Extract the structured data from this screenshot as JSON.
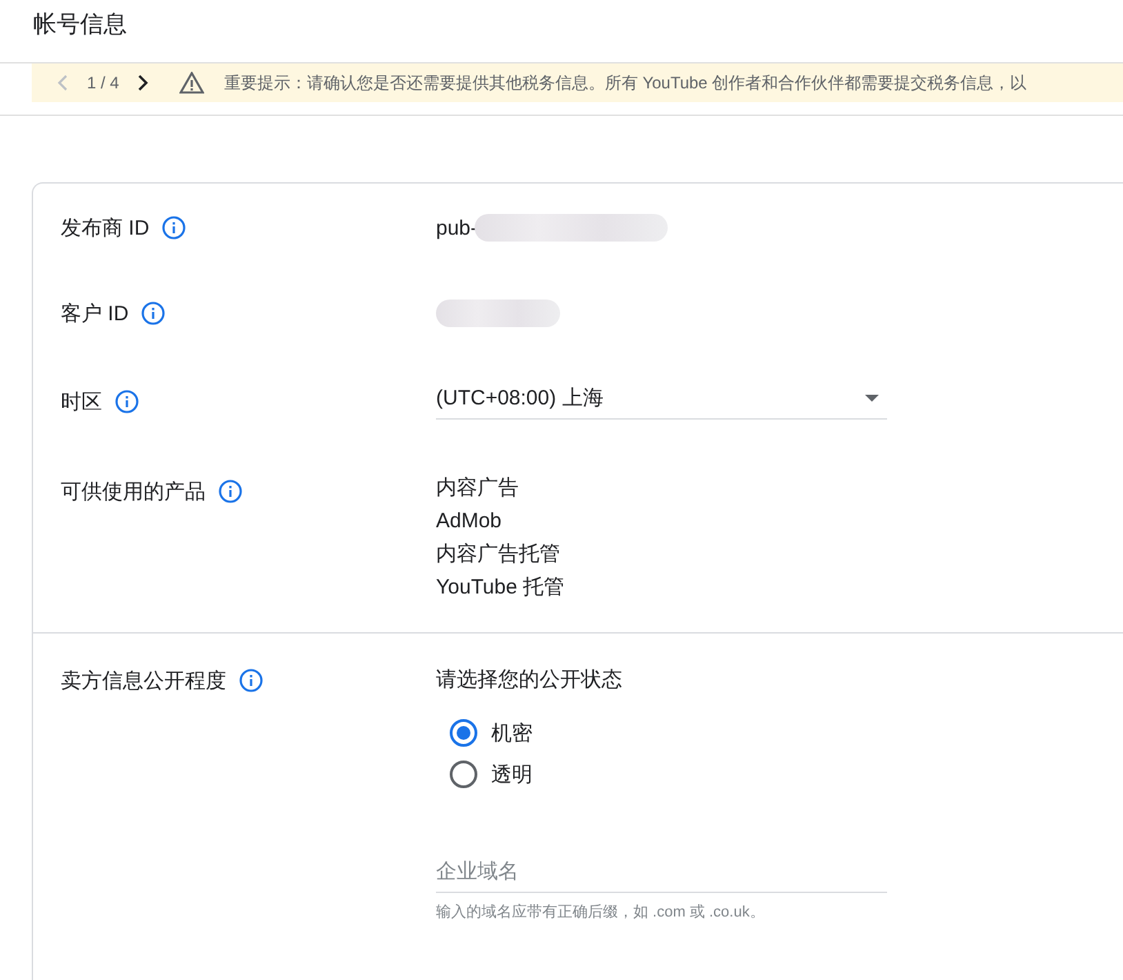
{
  "header": {
    "title": "帐号信息"
  },
  "banner": {
    "pager": "1 / 4",
    "message": "重要提示：请确认您是否还需要提供其他税务信息。所有 YouTube 创作者和合作伙伴都需要提交税务信息，以"
  },
  "fields": [
    {
      "kind": "redacted",
      "label": "发布商 ID",
      "value": "pub-"
    },
    {
      "kind": "redacted",
      "label": "客户 ID"
    },
    {
      "kind": "select",
      "label": "时区",
      "value": "(UTC+08:00) 上海"
    },
    {
      "kind": "list",
      "label": "可供使用的产品",
      "items": [
        "内容广告",
        "AdMob",
        "内容广告托管",
        "YouTube 托管"
      ]
    }
  ],
  "transparency": {
    "label": "卖方信息公开程度",
    "prompt": "请选择您的公开状态",
    "options": [
      {
        "label": "机密",
        "selected": true
      },
      {
        "label": "透明",
        "selected": false
      }
    ],
    "domain_field": {
      "placeholder": "企业域名",
      "hint": "输入的域名应带有正确后缀，如 .com 或 .co.uk。"
    }
  }
}
